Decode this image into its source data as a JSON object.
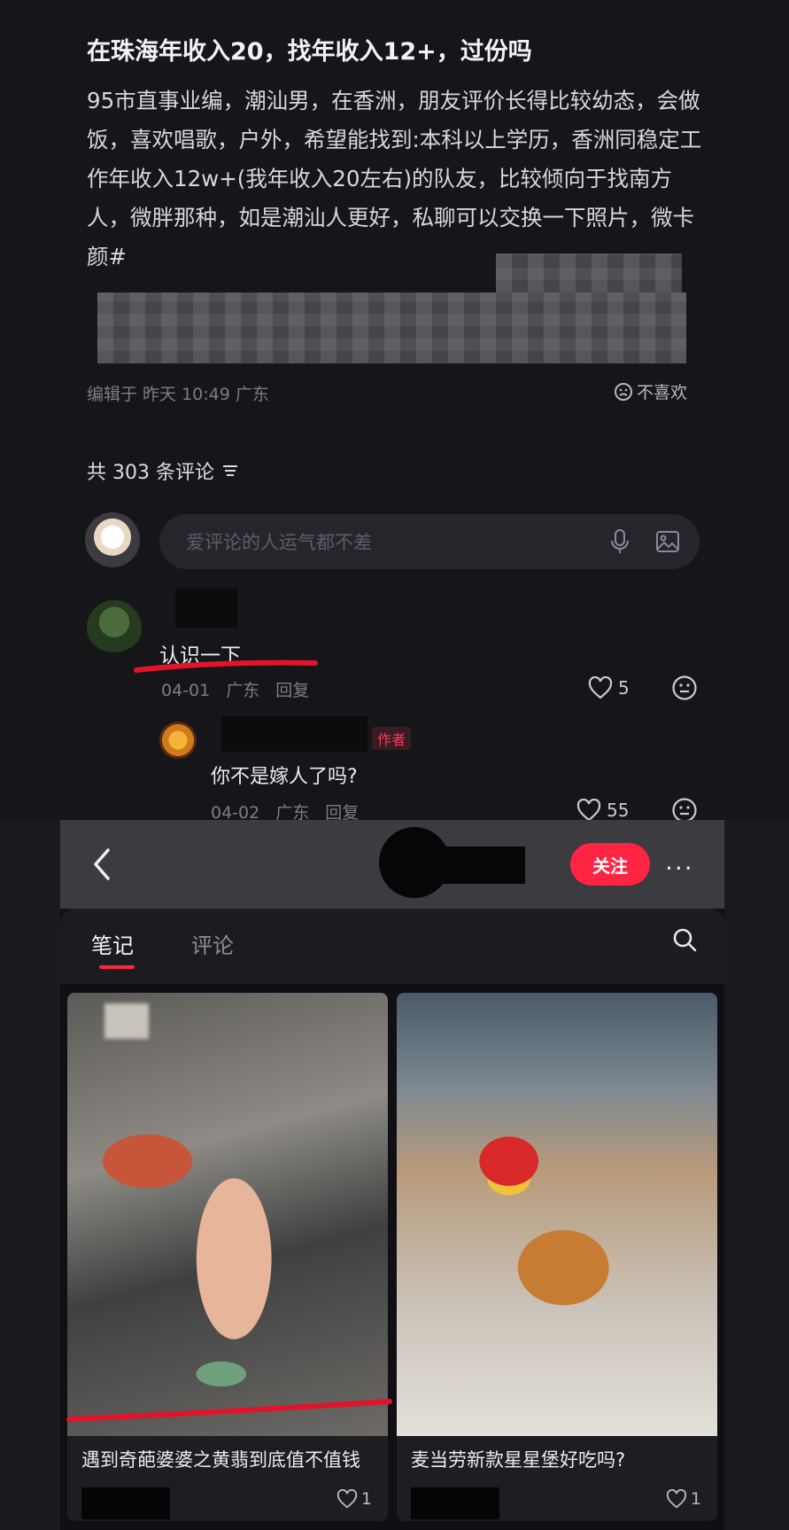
{
  "post": {
    "title": "在珠海年收入20，找年收入12+，过份吗",
    "body": "95市直事业编，潮汕男，在香洲，朋友评价长得比较幼态，会做饭，喜欢唱歌，户外，希望能找到:本科以上学历，香洲同稳定工作年收入12w+(我年收入20左右)的队友，比较倾向于找南方人，微胖那种，如是潮汕人更好，私聊可以交换一下照片，微卡颜#",
    "edited": "编辑于 昨天 10:49 广东",
    "dislike_label": "不喜欢"
  },
  "comments_header": {
    "count_label": "共 303 条评论"
  },
  "comment_input": {
    "placeholder": "爱评论的人运气都不差"
  },
  "comments": [
    {
      "text": "认识一下",
      "date": "04-01",
      "location": "广东",
      "reply_label": "回复",
      "likes": "5",
      "reply": {
        "badge": "作者",
        "text": "你不是嫁人了吗?",
        "date": "04-02",
        "location": "广东",
        "reply_label": "回复",
        "likes": "55"
      }
    }
  ],
  "profile": {
    "follow_label": "关注",
    "more_label": "···",
    "tabs": [
      {
        "label": "笔记"
      },
      {
        "label": "评论"
      }
    ]
  },
  "notes": [
    {
      "title": "遇到奇葩婆婆之黄翡到底值不值钱",
      "likes": "1"
    },
    {
      "title": "麦当劳新款星星堡好吃吗?",
      "likes": "1"
    }
  ],
  "colors": {
    "accent": "#ff2442",
    "annotation": "#e0142a"
  }
}
